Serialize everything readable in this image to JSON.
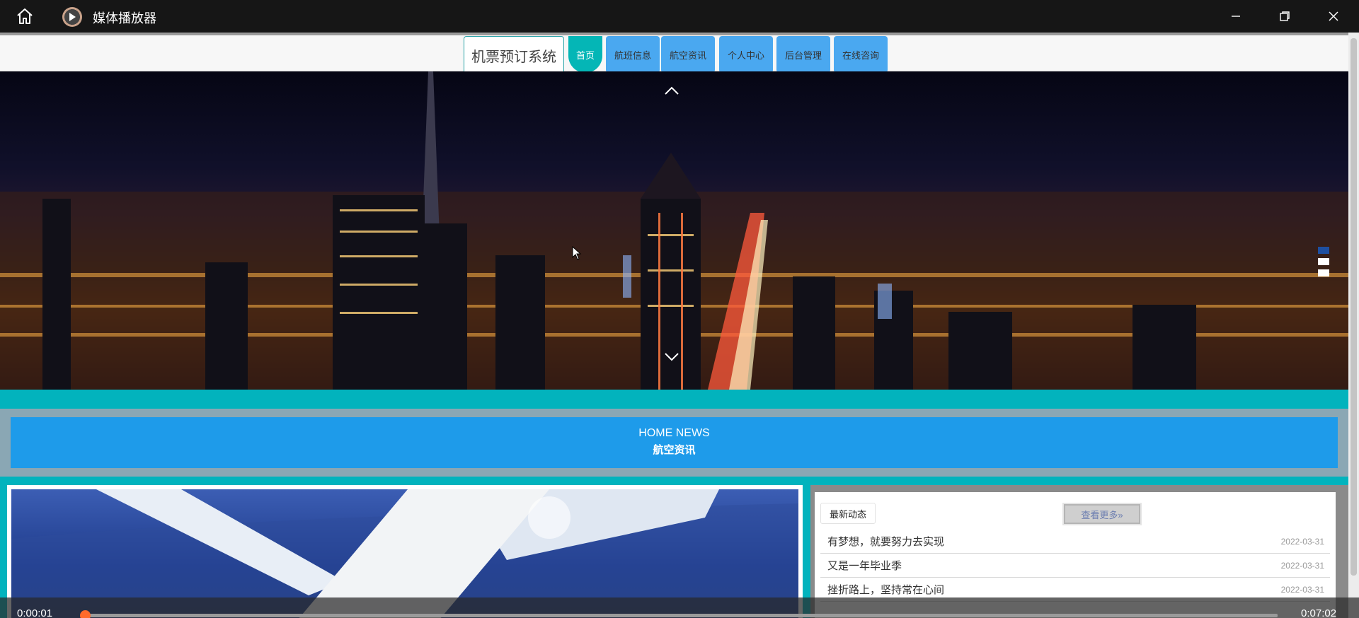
{
  "player": {
    "title": "媒体播放器",
    "current_time": "0:00:01",
    "duration": "0:07:02",
    "progress": 0.002
  },
  "site": {
    "brand": "机票预订系统",
    "nav": [
      {
        "label": "首页",
        "active": true
      },
      {
        "label": "航班信息"
      },
      {
        "label": "航空资讯"
      },
      {
        "label": "个人中心"
      },
      {
        "label": "后台管理"
      },
      {
        "label": "在线咨询"
      }
    ],
    "carousel": {
      "slides": 3,
      "active_index": 0
    }
  },
  "news_section": {
    "title_en": "HOME NEWS",
    "title_cn": "航空资讯"
  },
  "latest": {
    "tab_label": "最新动态",
    "more_label": "查看更多»",
    "items": [
      {
        "title": "有梦想，就要努力去实现",
        "date": "2022-03-31"
      },
      {
        "title": "又是一年毕业季",
        "date": "2022-03-31"
      },
      {
        "title": "挫折路上，坚持常在心间",
        "date": "2022-03-31"
      }
    ]
  },
  "colors": {
    "teal": "#02b3bd",
    "nav_blue": "#4aa8f0",
    "banner_blue": "#1e9bea",
    "progress_orange": "#ff6a2b"
  }
}
